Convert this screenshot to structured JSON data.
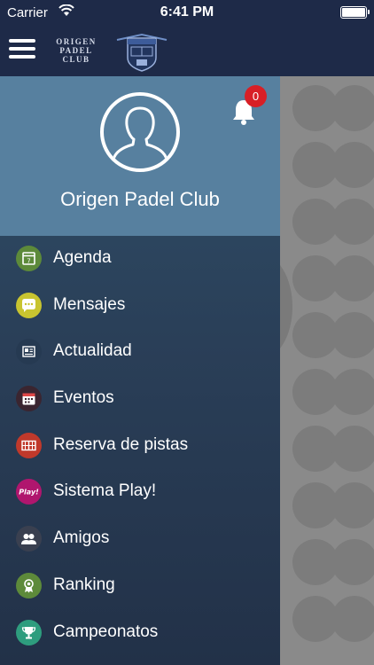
{
  "status_bar": {
    "carrier": "Carrier",
    "time": "6:41 PM"
  },
  "header": {
    "brand_lines": [
      "ORIGEN",
      "PADEL",
      "CLUB"
    ],
    "crest_icon": "gandasegui-crest-icon"
  },
  "profile": {
    "name": "Origen Padel Club",
    "notifications": "0"
  },
  "menu": {
    "items": [
      {
        "label": "Agenda",
        "icon": "calendar-icon",
        "color": "#5d8a3a"
      },
      {
        "label": "Mensajes",
        "icon": "chat-bubble-icon",
        "color": "#c8c430"
      },
      {
        "label": "Actualidad",
        "icon": "newspaper-icon",
        "color": "#263a52"
      },
      {
        "label": "Eventos",
        "icon": "event-calendar-icon",
        "color": "#3a2530"
      },
      {
        "label": "Reserva de pistas",
        "icon": "court-icon",
        "color": "#c0392b"
      },
      {
        "label": "Sistema Play!",
        "icon": "play-badge-icon",
        "color": "#b0166e"
      },
      {
        "label": "Amigos",
        "icon": "friends-icon",
        "color": "#3a4050"
      },
      {
        "label": "Ranking",
        "icon": "medal-icon",
        "color": "#5d8a3a"
      },
      {
        "label": "Campeonatos",
        "icon": "trophy-icon",
        "color": "#2e9d7e"
      }
    ]
  },
  "colors": {
    "header_bg": "#1e2a48",
    "profile_bg": "#57809f",
    "badge": "#d81f26"
  }
}
